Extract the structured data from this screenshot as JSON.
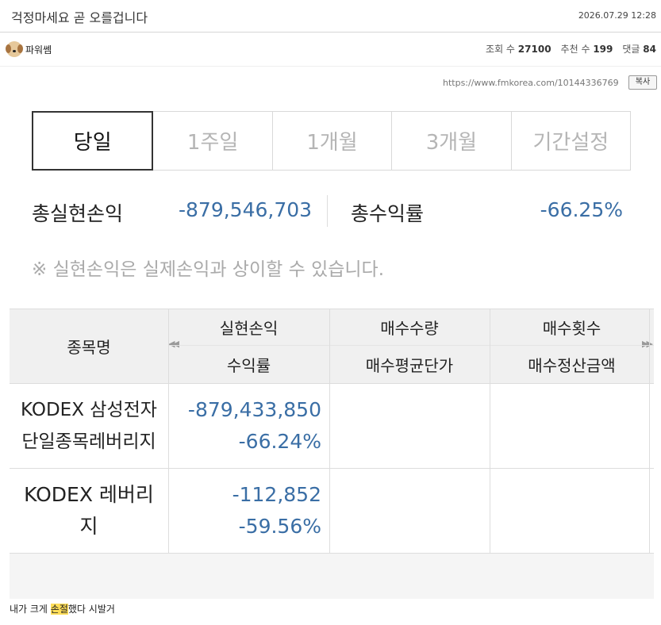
{
  "post": {
    "title": "걱정마세요 곧 오를겁니다",
    "datetime": "2026.07.29 12:28",
    "author": "파워쎔",
    "views_label": "조회 수",
    "views": "27100",
    "recommend_label": "추천 수",
    "recommend": "199",
    "comments_label": "댓글",
    "comments": "84",
    "url": "https://www.fmkorea.com/10144336769",
    "copy_label": "복사"
  },
  "screenshot": {
    "tabs": [
      "당일",
      "1주일",
      "1개월",
      "3개월",
      "기간설정"
    ],
    "active_tab": 0,
    "summary": {
      "total_pnl_label": "총실현손익",
      "total_pnl_value": "-879,546,703",
      "total_return_label": "총수익률",
      "total_return_value": "-66.25%"
    },
    "notice": "※ 실현손익은 실제손익과 상이할 수 있습니다.",
    "table": {
      "headers": {
        "name": "종목명",
        "pnl": "실현손익",
        "return": "수익률",
        "buy_qty": "매수수량",
        "buy_avg": "매수평균단가",
        "buy_count": "매수횟수",
        "buy_amount": "매수정산금액"
      },
      "rows": [
        {
          "name_line1": "KODEX 삼성전자",
          "name_line2": "단일종목레버리지",
          "pnl": "-879,433,850",
          "return": "-66.24%"
        },
        {
          "name_line1": "KODEX 레버리",
          "name_line2": "지",
          "pnl": "-112,852",
          "return": "-59.56%"
        }
      ]
    }
  },
  "caption": {
    "before": "내가 크게 ",
    "highlight": "손절",
    "after": "했다 시발거"
  },
  "colors": {
    "negative": "#3a6ea5",
    "highlight": "#ffde59"
  }
}
